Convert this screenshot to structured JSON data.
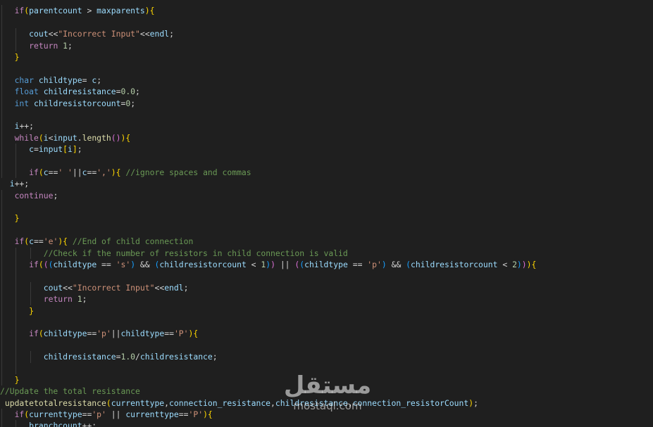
{
  "editor": {
    "lines": [
      {
        "indent": 0,
        "tokens": []
      },
      {
        "indent": 3,
        "tokens": [
          [
            "ctl",
            "if"
          ],
          [
            "p1",
            "("
          ],
          [
            "var",
            "parentcount"
          ],
          [
            "op",
            " > "
          ],
          [
            "var",
            "maxparents"
          ],
          [
            "p1",
            ")"
          ],
          [
            "p1",
            "{"
          ]
        ]
      },
      {
        "indent": 3,
        "tokens": []
      },
      {
        "indent": 6,
        "tokens": [
          [
            "var",
            "cout"
          ],
          [
            "op",
            "<<"
          ],
          [
            "str",
            "\"Incorrect Input\""
          ],
          [
            "op",
            "<<"
          ],
          [
            "var",
            "endl"
          ],
          [
            "op",
            ";"
          ]
        ]
      },
      {
        "indent": 6,
        "tokens": [
          [
            "ctl",
            "return"
          ],
          [
            "op",
            " "
          ],
          [
            "num",
            "1"
          ],
          [
            "op",
            ";"
          ]
        ]
      },
      {
        "indent": 3,
        "tokens": [
          [
            "p1",
            "}"
          ]
        ]
      },
      {
        "indent": 3,
        "tokens": []
      },
      {
        "indent": 3,
        "tokens": [
          [
            "kw",
            "char"
          ],
          [
            "op",
            " "
          ],
          [
            "var",
            "childtype"
          ],
          [
            "op",
            "= "
          ],
          [
            "var",
            "c"
          ],
          [
            "op",
            ";"
          ]
        ]
      },
      {
        "indent": 3,
        "tokens": [
          [
            "kw",
            "float"
          ],
          [
            "op",
            " "
          ],
          [
            "var",
            "childresistance"
          ],
          [
            "op",
            "="
          ],
          [
            "num",
            "0.0"
          ],
          [
            "op",
            ";"
          ]
        ]
      },
      {
        "indent": 3,
        "tokens": [
          [
            "kw",
            "int"
          ],
          [
            "op",
            " "
          ],
          [
            "var",
            "childresistorcount"
          ],
          [
            "op",
            "="
          ],
          [
            "num",
            "0"
          ],
          [
            "op",
            ";"
          ]
        ]
      },
      {
        "indent": 3,
        "tokens": []
      },
      {
        "indent": 3,
        "tokens": [
          [
            "var",
            "i"
          ],
          [
            "op",
            "++;"
          ]
        ]
      },
      {
        "indent": 3,
        "tokens": [
          [
            "ctl",
            "while"
          ],
          [
            "p1",
            "("
          ],
          [
            "var",
            "i"
          ],
          [
            "op",
            "<"
          ],
          [
            "var",
            "input"
          ],
          [
            "op",
            "."
          ],
          [
            "fn",
            "length"
          ],
          [
            "p2",
            "()"
          ],
          [
            "p1",
            ")"
          ],
          [
            "p1",
            "{"
          ]
        ]
      },
      {
        "indent": 6,
        "tokens": [
          [
            "var",
            "c"
          ],
          [
            "op",
            "="
          ],
          [
            "var",
            "input"
          ],
          [
            "p1",
            "["
          ],
          [
            "var",
            "i"
          ],
          [
            "p1",
            "]"
          ],
          [
            "op",
            ";"
          ]
        ]
      },
      {
        "indent": 6,
        "tokens": []
      },
      {
        "indent": 6,
        "tokens": [
          [
            "ctl",
            "if"
          ],
          [
            "p1",
            "("
          ],
          [
            "var",
            "c"
          ],
          [
            "op",
            "=="
          ],
          [
            "str",
            "' '"
          ],
          [
            "op",
            "||"
          ],
          [
            "var",
            "c"
          ],
          [
            "op",
            "=="
          ],
          [
            "str",
            "','"
          ],
          [
            "p1",
            ")"
          ],
          [
            "p1",
            "{"
          ],
          [
            "op",
            " "
          ],
          [
            "cm",
            "//ignore spaces and commas"
          ]
        ]
      },
      {
        "indent": 2,
        "tokens": [
          [
            "var",
            "i"
          ],
          [
            "op",
            "++;"
          ]
        ]
      },
      {
        "indent": 3,
        "tokens": [
          [
            "ctl",
            "continue"
          ],
          [
            "op",
            ";"
          ]
        ]
      },
      {
        "indent": 3,
        "tokens": []
      },
      {
        "indent": 3,
        "tokens": [
          [
            "p1",
            "}"
          ]
        ]
      },
      {
        "indent": 3,
        "tokens": []
      },
      {
        "indent": 3,
        "tokens": [
          [
            "ctl",
            "if"
          ],
          [
            "p1",
            "("
          ],
          [
            "var",
            "c"
          ],
          [
            "op",
            "=="
          ],
          [
            "str",
            "'e'"
          ],
          [
            "p1",
            ")"
          ],
          [
            "p1",
            "{"
          ],
          [
            "op",
            " "
          ],
          [
            "cm",
            "//End of child connection"
          ]
        ]
      },
      {
        "indent": 9,
        "tokens": [
          [
            "cm",
            "//Check if the number of resistors in child connection is valid"
          ]
        ]
      },
      {
        "indent": 6,
        "tokens": [
          [
            "ctl",
            "if"
          ],
          [
            "p1",
            "("
          ],
          [
            "p2",
            "("
          ],
          [
            "p3",
            "("
          ],
          [
            "var",
            "childtype"
          ],
          [
            "op",
            " == "
          ],
          [
            "str",
            "'s'"
          ],
          [
            "p3",
            ")"
          ],
          [
            "op",
            " && "
          ],
          [
            "p3",
            "("
          ],
          [
            "var",
            "childresistorcount"
          ],
          [
            "op",
            " < "
          ],
          [
            "num",
            "1"
          ],
          [
            "p3",
            ")"
          ],
          [
            "p2",
            ")"
          ],
          [
            "op",
            " || "
          ],
          [
            "p2",
            "("
          ],
          [
            "p3",
            "("
          ],
          [
            "var",
            "childtype"
          ],
          [
            "op",
            " == "
          ],
          [
            "str",
            "'p'"
          ],
          [
            "p3",
            ")"
          ],
          [
            "op",
            " && "
          ],
          [
            "p3",
            "("
          ],
          [
            "var",
            "childresistorcount"
          ],
          [
            "op",
            " < "
          ],
          [
            "num",
            "2"
          ],
          [
            "p3",
            ")"
          ],
          [
            "p2",
            ")"
          ],
          [
            "p1",
            ")"
          ],
          [
            "p1",
            "{"
          ]
        ]
      },
      {
        "indent": 6,
        "tokens": []
      },
      {
        "indent": 9,
        "tokens": [
          [
            "var",
            "cout"
          ],
          [
            "op",
            "<<"
          ],
          [
            "str",
            "\"Incorrect Input\""
          ],
          [
            "op",
            "<<"
          ],
          [
            "var",
            "endl"
          ],
          [
            "op",
            ";"
          ]
        ]
      },
      {
        "indent": 9,
        "tokens": [
          [
            "ctl",
            "return"
          ],
          [
            "op",
            " "
          ],
          [
            "num",
            "1"
          ],
          [
            "op",
            ";"
          ]
        ]
      },
      {
        "indent": 6,
        "tokens": [
          [
            "p1",
            "}"
          ]
        ]
      },
      {
        "indent": 6,
        "tokens": []
      },
      {
        "indent": 6,
        "tokens": [
          [
            "ctl",
            "if"
          ],
          [
            "p1",
            "("
          ],
          [
            "var",
            "childtype"
          ],
          [
            "op",
            "=="
          ],
          [
            "str",
            "'p'"
          ],
          [
            "op",
            "||"
          ],
          [
            "var",
            "childtype"
          ],
          [
            "op",
            "=="
          ],
          [
            "str",
            "'P'"
          ],
          [
            "p1",
            ")"
          ],
          [
            "p1",
            "{"
          ]
        ]
      },
      {
        "indent": 6,
        "tokens": []
      },
      {
        "indent": 9,
        "tokens": [
          [
            "var",
            "childresistance"
          ],
          [
            "op",
            "="
          ],
          [
            "num",
            "1.0"
          ],
          [
            "op",
            "/"
          ],
          [
            "var",
            "childresistance"
          ],
          [
            "op",
            ";"
          ]
        ]
      },
      {
        "indent": 6,
        "tokens": []
      },
      {
        "indent": 3,
        "tokens": [
          [
            "p1",
            "}"
          ]
        ]
      },
      {
        "indent": 0,
        "tokens": [
          [
            "cm",
            "//Update the total resistance"
          ]
        ]
      },
      {
        "indent": 0,
        "tokens": [
          [
            "op",
            " "
          ],
          [
            "fn",
            "updatetotalresistance"
          ],
          [
            "p1",
            "("
          ],
          [
            "var",
            "currenttype"
          ],
          [
            "op",
            ","
          ],
          [
            "var",
            "connection_resistance"
          ],
          [
            "op",
            ","
          ],
          [
            "var",
            "childresistance"
          ],
          [
            "op",
            ","
          ],
          [
            "var",
            "connection_resistorCount"
          ],
          [
            "p1",
            ")"
          ],
          [
            "op",
            ";"
          ]
        ]
      },
      {
        "indent": 3,
        "tokens": [
          [
            "ctl",
            "if"
          ],
          [
            "p1",
            "("
          ],
          [
            "var",
            "currenttype"
          ],
          [
            "op",
            "=="
          ],
          [
            "str",
            "'p'"
          ],
          [
            "op",
            " || "
          ],
          [
            "var",
            "currenttype"
          ],
          [
            "op",
            "=="
          ],
          [
            "str",
            "'P'"
          ],
          [
            "p1",
            ")"
          ],
          [
            "p1",
            "{"
          ]
        ]
      },
      {
        "indent": 6,
        "tokens": [
          [
            "var",
            "branchcount"
          ],
          [
            "op",
            "++;"
          ]
        ]
      },
      {
        "indent": 3,
        "tokens": [
          [
            "p1",
            "}"
          ]
        ]
      }
    ]
  },
  "watermark": {
    "arabic": "مستقل",
    "latin": "mostaql.com"
  },
  "colors": {
    "background": "#1f1f1f",
    "keyword": "#569cd6",
    "control": "#c586c0",
    "function": "#dcdcaa",
    "string": "#ce9178",
    "number": "#b5cea8",
    "variable": "#9cdcfe",
    "comment": "#6a9955"
  }
}
